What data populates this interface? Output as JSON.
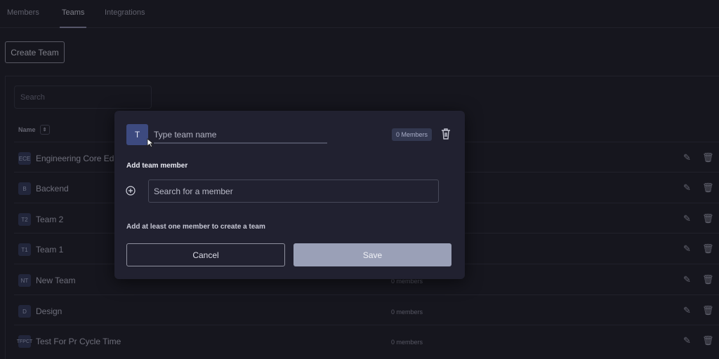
{
  "tabs": [
    {
      "label": "Members",
      "active": false
    },
    {
      "label": "Teams",
      "active": true
    },
    {
      "label": "Integrations",
      "active": false
    }
  ],
  "toolbar": {
    "create_label": "Create Team"
  },
  "search": {
    "placeholder": "Search"
  },
  "table": {
    "name_header": "Name",
    "rows": [
      {
        "initials": "ECE",
        "name": "Engineering Core Ed",
        "count": "",
        "edit_icon": "pencil-icon",
        "delete_icon": "trash-icon"
      },
      {
        "initials": "B",
        "name": "Backend",
        "count": ""
      },
      {
        "initials": "T2",
        "name": "Team 2",
        "count": ""
      },
      {
        "initials": "T1",
        "name": "Team 1",
        "count": ""
      },
      {
        "initials": "NT",
        "name": "New Team",
        "count": "0 members"
      },
      {
        "initials": "D",
        "name": "Design",
        "count": "0 members"
      },
      {
        "initials": "TFPCT",
        "name": "Test For Pr Cycle Time",
        "count": "0 members"
      }
    ]
  },
  "modal": {
    "avatar_initial": "T",
    "team_name_placeholder": "Type team name",
    "members_badge": "0 Members",
    "add_member_title": "Add team member",
    "member_search_placeholder": "Search for a member",
    "hint": "Add at least one member to create a team",
    "cancel_label": "Cancel",
    "save_label": "Save"
  },
  "colors": {
    "background": "#16161e",
    "modal_bg": "#212130",
    "accent_avatar": "#3d4a7f",
    "save_disabled": "#9aa0b7"
  }
}
